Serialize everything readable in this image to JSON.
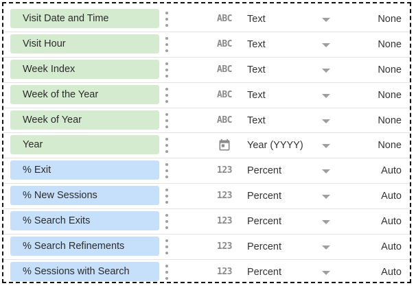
{
  "fields": [
    {
      "name": "Visit Date and Time",
      "kind": "dimension",
      "type_icon": "ABC",
      "type_icon_name": "text-type-icon",
      "type": "Text",
      "aggregation": "None"
    },
    {
      "name": "Visit Hour",
      "kind": "dimension",
      "type_icon": "ABC",
      "type_icon_name": "text-type-icon",
      "type": "Text",
      "aggregation": "None"
    },
    {
      "name": "Week Index",
      "kind": "dimension",
      "type_icon": "ABC",
      "type_icon_name": "text-type-icon",
      "type": "Text",
      "aggregation": "None"
    },
    {
      "name": "Week of the Year",
      "kind": "dimension",
      "type_icon": "ABC",
      "type_icon_name": "text-type-icon",
      "type": "Text",
      "aggregation": "None"
    },
    {
      "name": "Week of Year",
      "kind": "dimension",
      "type_icon": "ABC",
      "type_icon_name": "text-type-icon",
      "type": "Text",
      "aggregation": "None"
    },
    {
      "name": "Year",
      "kind": "dimension",
      "type_icon": "",
      "type_icon_name": "calendar-icon",
      "type": "Year (YYYY)",
      "aggregation": "None"
    },
    {
      "name": "% Exit",
      "kind": "metric",
      "type_icon": "123",
      "type_icon_name": "number-type-icon",
      "type": "Percent",
      "aggregation": "Auto"
    },
    {
      "name": "% New Sessions",
      "kind": "metric",
      "type_icon": "123",
      "type_icon_name": "number-type-icon",
      "type": "Percent",
      "aggregation": "Auto"
    },
    {
      "name": "% Search Exits",
      "kind": "metric",
      "type_icon": "123",
      "type_icon_name": "number-type-icon",
      "type": "Percent",
      "aggregation": "Auto"
    },
    {
      "name": "% Search Refinements",
      "kind": "metric",
      "type_icon": "123",
      "type_icon_name": "number-type-icon",
      "type": "Percent",
      "aggregation": "Auto"
    },
    {
      "name": "% Sessions with Search",
      "kind": "metric",
      "type_icon": "123",
      "type_icon_name": "number-type-icon",
      "type": "Percent",
      "aggregation": "Auto"
    }
  ],
  "colors": {
    "dimension_chip": "#d4ebd0",
    "metric_chip": "#c6e0fb",
    "icon_gray": "#9e9e9e"
  }
}
